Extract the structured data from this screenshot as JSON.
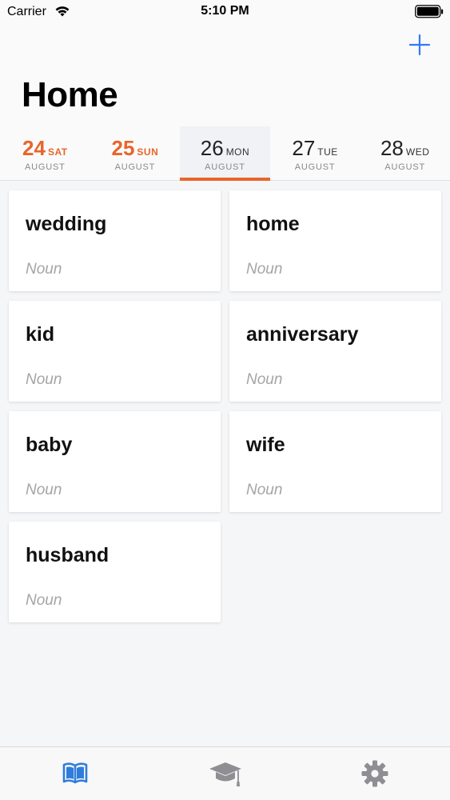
{
  "status_bar": {
    "carrier": "Carrier",
    "time": "5:10 PM"
  },
  "header": {
    "title": "Home",
    "add_icon": "plus-icon",
    "accent_color": "#3478f6"
  },
  "date_strip": {
    "selected_color": "#e8652a",
    "dates": [
      {
        "day": "24",
        "weekday": "SAT",
        "month": "AUGUST",
        "weekend": true,
        "selected": false
      },
      {
        "day": "25",
        "weekday": "SUN",
        "month": "AUGUST",
        "weekend": true,
        "selected": false
      },
      {
        "day": "26",
        "weekday": "MON",
        "month": "AUGUST",
        "weekend": false,
        "selected": true
      },
      {
        "day": "27",
        "weekday": "TUE",
        "month": "AUGUST",
        "weekend": false,
        "selected": false
      },
      {
        "day": "28",
        "weekday": "WED",
        "month": "AUGUST",
        "weekend": false,
        "selected": false
      }
    ]
  },
  "cards": [
    {
      "word": "wedding",
      "pos": "Noun"
    },
    {
      "word": "home",
      "pos": "Noun"
    },
    {
      "word": "kid",
      "pos": "Noun"
    },
    {
      "word": "anniversary",
      "pos": "Noun"
    },
    {
      "word": "baby",
      "pos": "Noun"
    },
    {
      "word": "wife",
      "pos": "Noun"
    },
    {
      "word": "husband",
      "pos": "Noun"
    }
  ],
  "tab_bar": {
    "active_color": "#2f7ddb",
    "inactive_color": "#8e8e93",
    "items": [
      {
        "icon": "book-icon",
        "active": true
      },
      {
        "icon": "graduation-cap-icon",
        "active": false
      },
      {
        "icon": "gear-icon",
        "active": false
      }
    ]
  }
}
